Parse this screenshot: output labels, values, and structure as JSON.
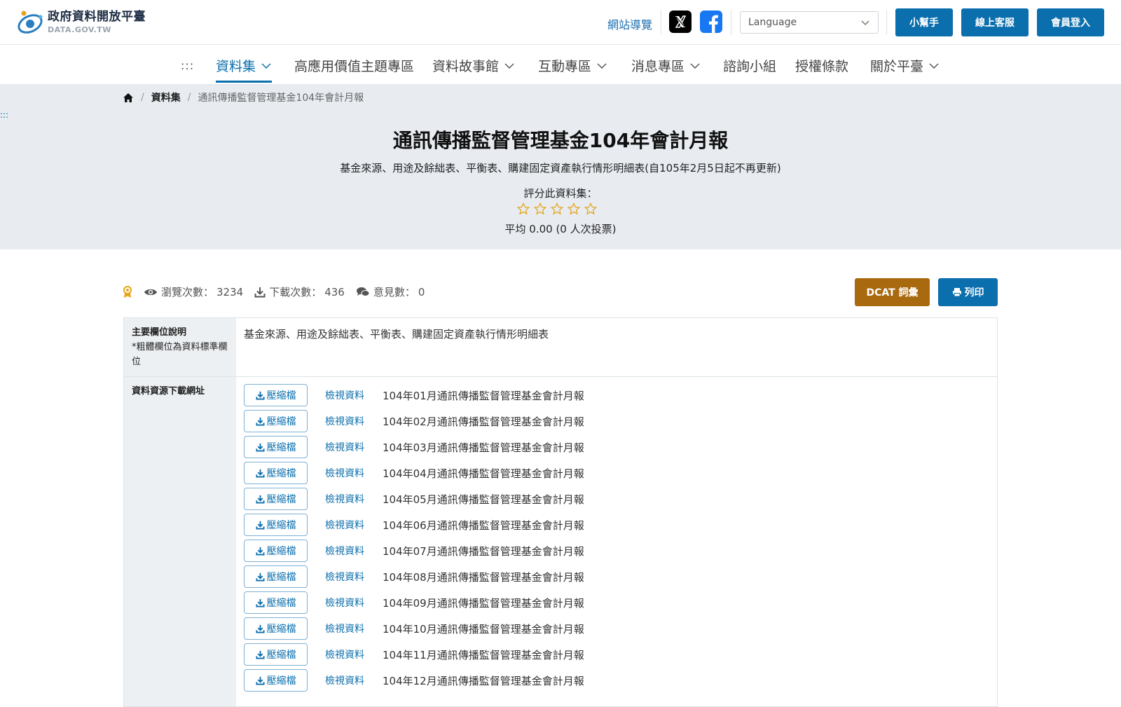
{
  "header": {
    "logo_cn": "政府資料開放平臺",
    "logo_en": "DATA.GOV.TW",
    "sitemap": "網站導覽",
    "language_placeholder": "Language",
    "helper_button": "小幫手",
    "support_button": "線上客服",
    "login_button": "會員登入"
  },
  "nav": {
    "dots": ":::",
    "items": [
      "資料集",
      "高應用價值主題專區",
      "資料故事館",
      "互動專區",
      "消息專區",
      "諮詢小組",
      "授權條款",
      "關於平臺"
    ]
  },
  "breadcrumb": {
    "level1": "資料集",
    "current": "通訊傳播監督管理基金104年會計月報"
  },
  "hero": {
    "dots": ":::",
    "title": "通訊傳播監督管理基金104年會計月報",
    "description": "基金來源、用途及餘絀表、平衡表、購建固定資產執行情形明細表(自105年2月5日起不再更新)",
    "rate_label": "評分此資料集：",
    "rating_stars": 0,
    "average": "平均 0.00 (0 人次投票)"
  },
  "stats": {
    "views_label": "瀏覽次數：",
    "views": "3234",
    "downloads_label": "下載次數：",
    "downloads": "436",
    "comments_label": "意見數：",
    "comments": "0"
  },
  "actions": {
    "dcat": "DCAT 詞彙",
    "print": "列印"
  },
  "table": {
    "main_fields_label": "主要欄位說明",
    "main_fields_note": "*粗體欄位為資料標準欄位",
    "main_fields_value": "基金來源、用途及餘絀表、平衡表、購建固定資產執行情形明細表",
    "resources_label": "資料資源下載網址",
    "zip_label": "壓縮檔",
    "view_label": "檢視資料",
    "resources": [
      "104年01月通訊傳播監督管理基金會計月報",
      "104年02月通訊傳播監督管理基金會計月報",
      "104年03月通訊傳播監督管理基金會計月報",
      "104年04月通訊傳播監督管理基金會計月報",
      "104年05月通訊傳播監督管理基金會計月報",
      "104年06月通訊傳播監督管理基金會計月報",
      "104年07月通訊傳播監督管理基金會計月報",
      "104年08月通訊傳播監督管理基金會計月報",
      "104年09月通訊傳播監督管理基金會計月報",
      "104年10月通訊傳播監督管理基金會計月報",
      "104年11月通訊傳播監督管理基金會計月報",
      "104年12月通訊傳播監督管理基金會計月報"
    ]
  },
  "colors": {
    "primary": "#0b6fad",
    "dcat": "#a8690f",
    "hero_bg": "#e8ecf1",
    "star": "#e3a51c"
  }
}
